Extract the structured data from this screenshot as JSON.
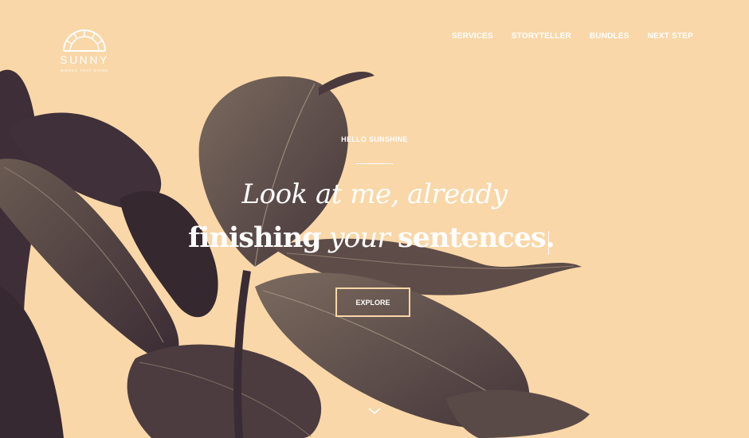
{
  "logo": {
    "title": "SUNNY",
    "tagline": "WORDS THAT SHINE",
    "icon": "sun-half-icon"
  },
  "nav": {
    "items": [
      {
        "label": "SERVICES"
      },
      {
        "label": "STORYTELLER"
      },
      {
        "label": "BUNDLES"
      },
      {
        "label": "NEXT STEP"
      }
    ]
  },
  "hero": {
    "eyebrow": "HELLO SUNSHINE",
    "headline_line1": "Look at me, already",
    "headline_line2_a": "finishing",
    "headline_line2_b": "your",
    "headline_line2_c": "sentences.",
    "button_label": "EXPLORE",
    "scroll_icon": "chevron-down-icon"
  },
  "colors": {
    "background": "#f9d7a8",
    "leaf_dark": "#3b2c36",
    "leaf_mid": "#5a4a47",
    "text": "#ffffff"
  }
}
